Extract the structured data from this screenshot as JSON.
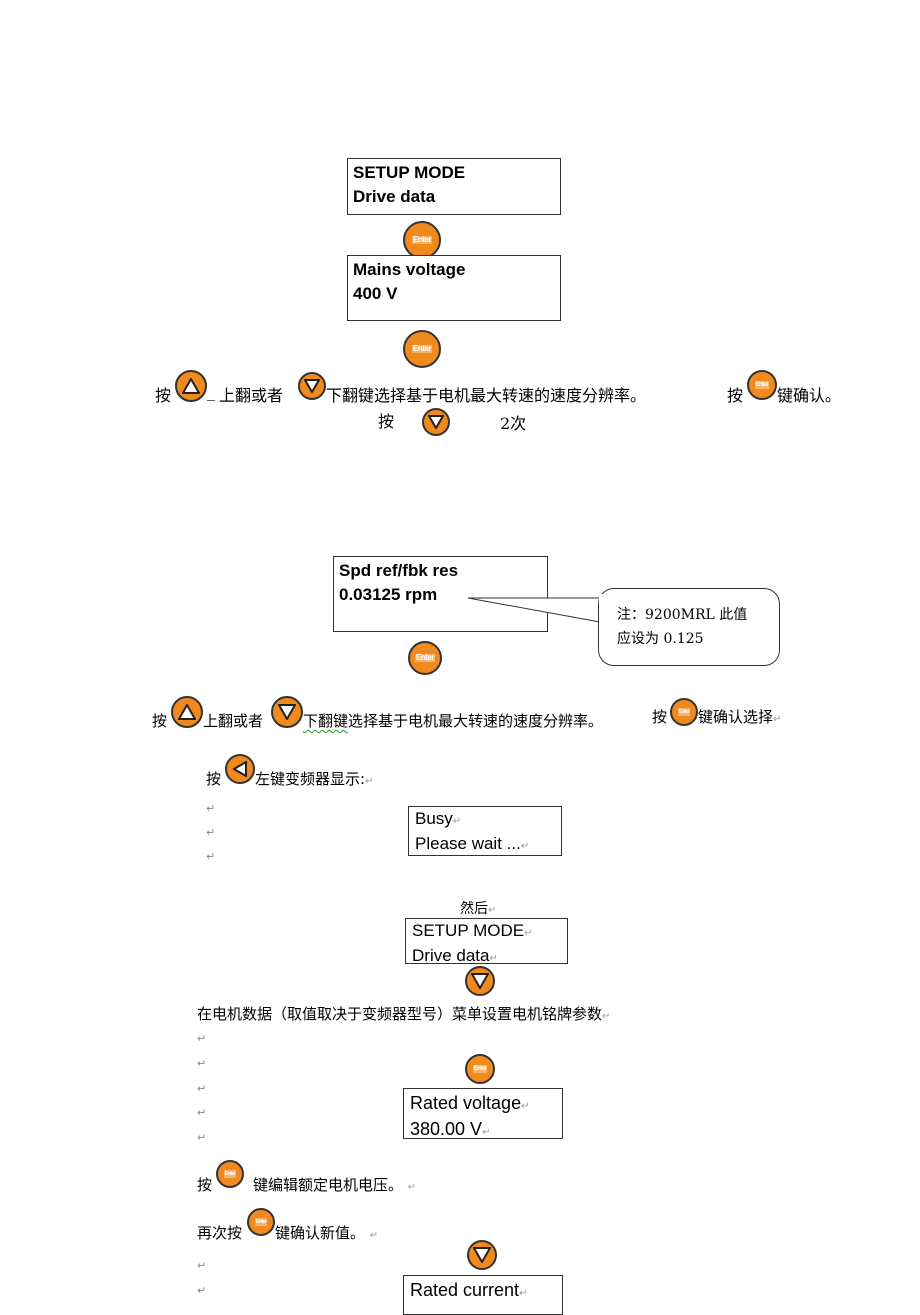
{
  "screens": {
    "setup_mode_1": {
      "line1": "SETUP MODE",
      "line2": "Drive data"
    },
    "mains_voltage": {
      "line1": "Mains voltage",
      "line2": "400 V"
    },
    "spd_ref": {
      "line1": "Spd ref/fbk res",
      "line2": "0.03125 rpm"
    },
    "busy": {
      "line1": "Busy",
      "line2": "Please wait ..."
    },
    "setup_mode_2": {
      "line1": "SETUP MODE",
      "line2": "Drive data"
    },
    "rated_voltage": {
      "line1": "Rated voltage",
      "line2": "380.00 V"
    },
    "rated_current": {
      "line1": "Rated current"
    }
  },
  "buttons": {
    "enter_label": "Enter"
  },
  "paragraphs": {
    "p1_press": "按",
    "p1_up": "上翻或者",
    "p1_down": "下翻键选择基于电机最大转速的速度分辨率。",
    "p1_press2": "按",
    "p1_confirm": "键确认。",
    "p2_press": "按",
    "p2_times": "2次",
    "callout_line1": "注：9200MRL  此值",
    "callout_line2": "应设为 0.125",
    "p3_press": "按",
    "p3_up": "上翻或者",
    "p3_down_a": "下翻键",
    "p3_down_b": "选择基于电机最大转速的速度分辨率。",
    "p3_press2": "按",
    "p3_confirm": "键确认选择",
    "p4_press": "按",
    "p4_left": "左键变频器显示:",
    "then": "然后",
    "p5": "在电机数据（取值取决于变频器型号）菜单设置电机铭牌参数",
    "p6_press": "按",
    "p6_edit": "键编辑额定电机电压。",
    "p7_press": "再次按",
    "p7_confirm": "键确认新值。"
  },
  "paragraph_mark": "↵"
}
